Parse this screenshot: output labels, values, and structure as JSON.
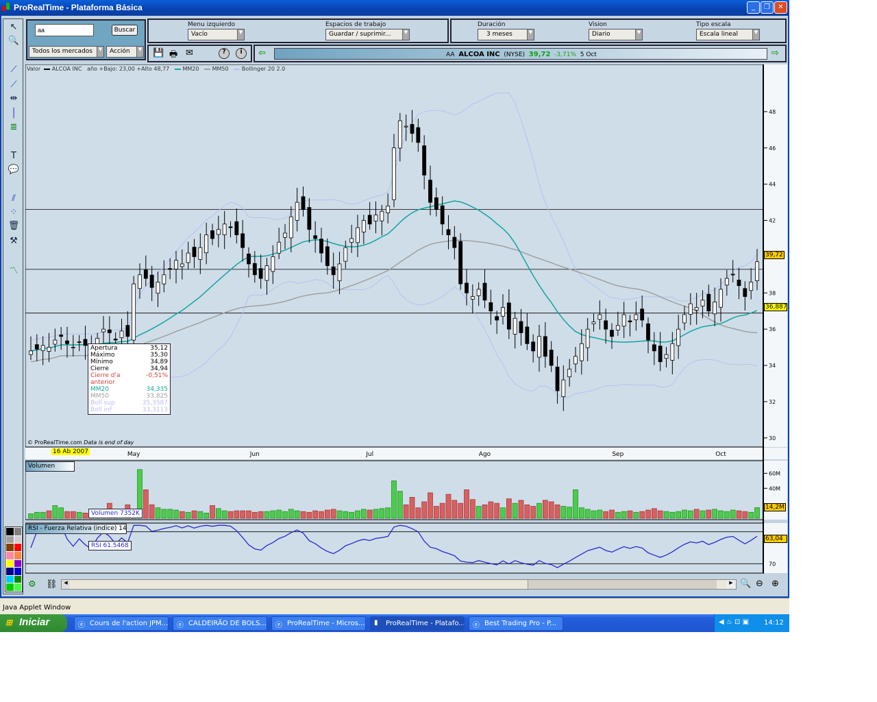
{
  "window": {
    "title": "ProRealTime - Plataforma Básica"
  },
  "search": {
    "value": "aa",
    "button": "Buscar",
    "market": "Todos los mercados",
    "type": "Acción"
  },
  "controls": {
    "menu_label": "Menu izquierdo",
    "menu_value": "Vacío",
    "workspace_label": "Espacios de trabajo",
    "workspace_value": "Guardar / suprimir...",
    "duration_label": "Duración",
    "duration_value": "3 meses",
    "vision_label": "Vision",
    "vision_value": "Diario",
    "scale_label": "Tipo escala",
    "scale_value": "Escala lineal"
  },
  "quote": {
    "ticker": "AA",
    "name": "ALCOA INC",
    "exchange": "(NYSE)",
    "price": "39,72",
    "change": "-3,71%",
    "date": "5 Oct",
    "price_color": "#12a012"
  },
  "legend": {
    "valor": "Valor",
    "name": "ALCOA INC",
    "range": "año +Bajo: 23,00 +Alto 48,77",
    "mm20": "MM20",
    "mm50": "MM50",
    "boll": "Bollinger 20 2.0"
  },
  "colors": {
    "mm20": "#12a5a0",
    "mm50": "#a0a0a0",
    "boll": "#b8c0f0",
    "up_volume": "#4ccc4c",
    "down_volume": "#d86060",
    "rsi": "#2828d0"
  },
  "copyright": "© ProRealTime.com",
  "data_note": "Data is end of day",
  "cursor_date": "16 Ab 2007",
  "tooltip": [
    {
      "label": "Apertura",
      "value": "35,12",
      "color": "#000"
    },
    {
      "label": "Máximo",
      "value": "35,30",
      "color": "#000"
    },
    {
      "label": "Mínimo",
      "value": "34,89",
      "color": "#000"
    },
    {
      "label": "Cierre",
      "value": "34,94",
      "color": "#000"
    },
    {
      "label": "Cierre d'a anterior",
      "value": "-0,51%",
      "color": "#d04040"
    },
    {
      "label": "MM20",
      "value": "34,335",
      "color": "#12a5a0"
    },
    {
      "label": "MM50",
      "value": "33,825",
      "color": "#a0a0a0"
    },
    {
      "label": "Boll sup",
      "value": "35,3587",
      "color": "#b8c0f0"
    },
    {
      "label": "Boll inf",
      "value": "33,3113",
      "color": "#b8c0f0"
    }
  ],
  "volume_panel": {
    "title": "Volumen",
    "cursor": "Volumen 7352K",
    "last": "14,2M",
    "ticks": [
      "60M",
      "40M"
    ]
  },
  "rsi_panel": {
    "title": "RSI - Fuerza Relativa (indice) 14",
    "cursor": "RSI 61.5468",
    "last": "63,04",
    "ticks": [
      "70"
    ]
  },
  "price_labels": {
    "last": "39,72",
    "line": "36,887"
  },
  "chart_data": {
    "type": "candlestick",
    "ylim": [
      29.5,
      50
    ],
    "y_ticks": [
      30,
      32,
      34,
      36,
      38,
      40,
      42,
      44,
      46,
      48
    ],
    "x_ticks": [
      {
        "label": "May",
        "index": 17
      },
      {
        "label": "Jun",
        "index": 37
      },
      {
        "label": "Jul",
        "index": 56
      },
      {
        "label": "Ago",
        "index": 75
      },
      {
        "label": "Sep",
        "index": 97
      },
      {
        "label": "Oct",
        "index": 114
      }
    ],
    "horizontal_lines": [
      42.6,
      39.3,
      36.887
    ],
    "close": [
      34.8,
      34.9,
      35.1,
      35.0,
      35.4,
      35.6,
      35.2,
      35.0,
      35.3,
      35.1,
      34.94,
      35.5,
      36.0,
      35.8,
      35.4,
      35.9,
      35.6,
      38.5,
      39.0,
      38.8,
      38.3,
      38.6,
      39.0,
      39.3,
      39.8,
      39.6,
      40.2,
      40.0,
      40.5,
      41.2,
      41.0,
      41.5,
      41.8,
      41.6,
      41.2,
      40.5,
      39.6,
      39.0,
      38.8,
      39.5,
      40.0,
      40.8,
      41.3,
      42.2,
      43.0,
      42.6,
      41.5,
      41.0,
      40.2,
      39.5,
      39.0,
      39.6,
      40.5,
      41.0,
      41.6,
      42.0,
      41.8,
      42.3,
      42.5,
      42.8,
      46.0,
      47.5,
      47.2,
      46.8,
      46.3,
      44.5,
      43.0,
      42.6,
      41.8,
      41.2,
      40.5,
      38.5,
      38.0,
      37.8,
      38.2,
      37.6,
      37.0,
      36.5,
      37.2,
      36.0,
      36.6,
      35.8,
      35.2,
      34.8,
      35.6,
      34.5,
      34.0,
      32.6,
      33.2,
      33.8,
      34.5,
      35.2,
      36.0,
      36.4,
      36.8,
      36.0,
      35.6,
      36.2,
      36.8,
      36.4,
      36.8,
      36.5,
      35.4,
      34.8,
      34.2,
      34.6,
      35.2,
      36.0,
      36.8,
      37.4,
      37.2,
      37.6,
      37.0,
      37.5,
      38.2,
      38.8,
      39.0,
      38.4,
      37.8,
      38.6,
      39.72
    ],
    "volume_millions": [
      6,
      8,
      8,
      10,
      17,
      14,
      9,
      9,
      8,
      7,
      7,
      7,
      8,
      20,
      8,
      9,
      18,
      9,
      65,
      38,
      18,
      14,
      12,
      12,
      11,
      9,
      8,
      10,
      9,
      7,
      17,
      13,
      10,
      9,
      10,
      10,
      10,
      8,
      9,
      9,
      10,
      11,
      9,
      12,
      10,
      9,
      8,
      10,
      9,
      11,
      12,
      10,
      9,
      8,
      10,
      12,
      11,
      12,
      13,
      14,
      50,
      36,
      18,
      28,
      14,
      22,
      34,
      16,
      20,
      32,
      24,
      20,
      38,
      25,
      16,
      18,
      22,
      20,
      14,
      26,
      20,
      24,
      18,
      16,
      20,
      24,
      22,
      18,
      16,
      15,
      38,
      14,
      12,
      10,
      11,
      9,
      11,
      8,
      9,
      10,
      8,
      9,
      11,
      13,
      10,
      9,
      8,
      9,
      11,
      10,
      12,
      10,
      11,
      12,
      10,
      9,
      11,
      10,
      9,
      8,
      14.2
    ]
  },
  "scrollbar": {
    "position": 0.92
  },
  "applet_status": "Java Applet Window",
  "taskbar": {
    "start": "Iniciar",
    "tasks": [
      "Cours de l'action JPM...",
      "CALDEIRÃO DE BOLS...",
      "ProRealTime - Micros...",
      "ProRealTime - Platafo...",
      "Best Trading Pro - P..."
    ],
    "active": 3,
    "clock": "14:12"
  }
}
